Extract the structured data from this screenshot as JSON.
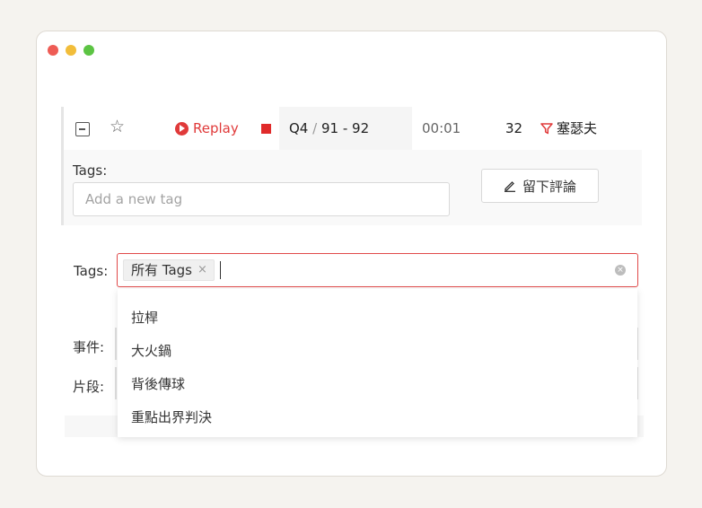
{
  "window": {
    "traffic_colors": [
      "#ee5c55",
      "#f2bd3a",
      "#5cc443"
    ]
  },
  "event_row": {
    "replay_label": "Replay",
    "period": "Q4",
    "slash": "/",
    "score": "91 - 92",
    "clock": "00:01",
    "count": "32",
    "team": "塞瑟夫",
    "accent_color": "#e03a3a"
  },
  "event_tags": {
    "label": "Tags:",
    "placeholder": "Add a new tag",
    "comment_button": "留下評論"
  },
  "filter": {
    "tags_label": "Tags",
    "colon": ":",
    "selected_chip": "所有 Tags",
    "chip_remove": "×",
    "event_label": "事件:",
    "clip_label": "片段:",
    "dropdown_options": [
      "拉桿",
      "大火鍋",
      "背後傳球",
      "重點出界判決"
    ]
  }
}
